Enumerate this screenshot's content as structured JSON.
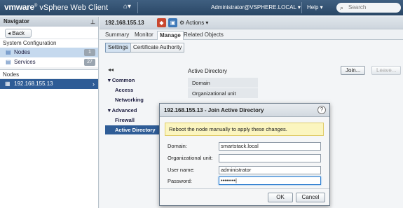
{
  "topbar": {
    "brand_vm": "vmware",
    "brand_product": "vSphere Web Client",
    "home_icon": "home-icon",
    "user": "Administrator@VSPHERE.LOCAL",
    "help": "Help",
    "search_placeholder": "Search"
  },
  "navigator": {
    "title": "Navigator",
    "back": "Back",
    "section": "System Configuration",
    "items": [
      {
        "label": "Nodes",
        "count": "1",
        "icon": "nodes-icon"
      },
      {
        "label": "Services",
        "count": "27",
        "icon": "services-icon"
      }
    ],
    "nodes_label": "Nodes",
    "node": "192.168.155.13"
  },
  "object": {
    "title": "192.168.155.13",
    "actions": "Actions"
  },
  "tabs": [
    "Summary",
    "Monitor",
    "Manage",
    "Related Objects"
  ],
  "subtabs": [
    "Settings",
    "Certificate Authority"
  ],
  "left_panel": {
    "common": "Common",
    "access": "Access",
    "networking": "Networking",
    "advanced": "Advanced",
    "firewall": "Firewall",
    "active_directory": "Active Directory"
  },
  "ad": {
    "title": "Active Directory",
    "join": "Join...",
    "leave": "Leave...",
    "rows": [
      "Domain",
      "Organizational unit"
    ]
  },
  "dialog": {
    "title": "192.168.155.13 - Join Active Directory",
    "warning": "Reboot the node manually to apply these changes.",
    "domain_label": "Domain:",
    "domain_value": "smartstack.local",
    "ou_label": "Organizational unit:",
    "ou_value": "",
    "user_label": "User name:",
    "user_value": "administrator",
    "password_label": "Password:",
    "password_value": "••••••••|",
    "ok": "OK",
    "cancel": "Cancel"
  }
}
